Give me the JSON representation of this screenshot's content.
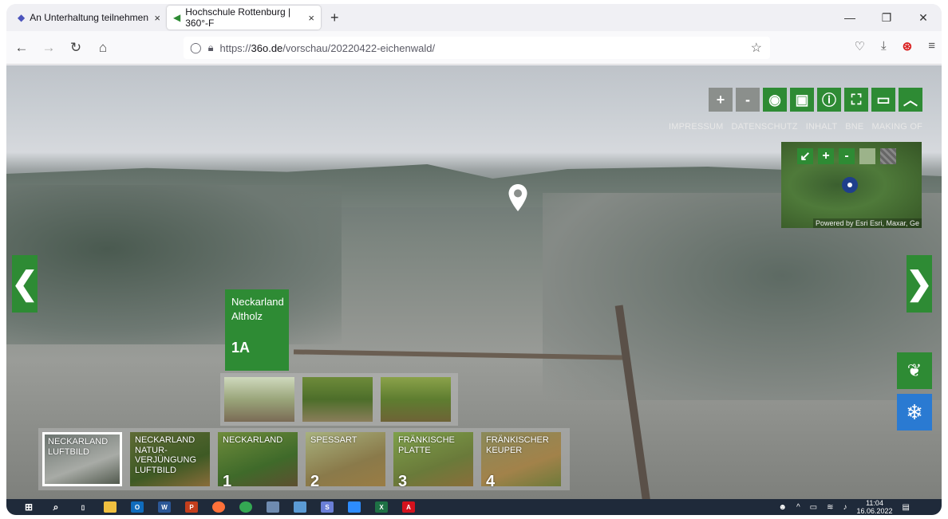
{
  "browser": {
    "tabs": [
      {
        "label": "An Unterhaltung teilnehmen",
        "close": "×"
      },
      {
        "label": "Hochschule Rottenburg | 360°-F",
        "close": "×"
      }
    ],
    "new_tab": "+",
    "url_prefix": "https://",
    "url_host": "36o.de",
    "url_path": "/vorschau/20220422-eichenwald/"
  },
  "viewer": {
    "toolbar": [
      "+",
      "-",
      "globe-icon",
      "image-icon",
      "info-icon",
      "fullscreen-icon",
      "vr-icon",
      "chevron-up-icon"
    ],
    "links": [
      "IMPRESSUM",
      "DATENSCHUTZ",
      "INHALT",
      "BNE",
      "MAKING OF"
    ],
    "minimap": {
      "credit": "Powered by Esri Esri, Maxar, Ge"
    },
    "card": {
      "title_line1": "Neckarland",
      "title_line2": "Altholz",
      "number": "1A"
    },
    "nav": [
      {
        "label": "NECKARLAND LUFTBILD",
        "num": ""
      },
      {
        "label": "NECKARLAND NATUR-VERJÜNGUNG LUFTBILD",
        "num": ""
      },
      {
        "label": "NECKARLAND",
        "num": "1"
      },
      {
        "label": "SPESSART",
        "num": "2"
      },
      {
        "label": "FRÄNKISCHE PLATTE",
        "num": "3"
      },
      {
        "label": "FRÄNKISCHER KEUPER",
        "num": "4"
      }
    ]
  },
  "taskbar": {
    "time": "11:04",
    "date": "16.06.2022"
  },
  "colors": {
    "accent_green": "#2e8b34",
    "snow_blue": "#2a7ad2"
  }
}
